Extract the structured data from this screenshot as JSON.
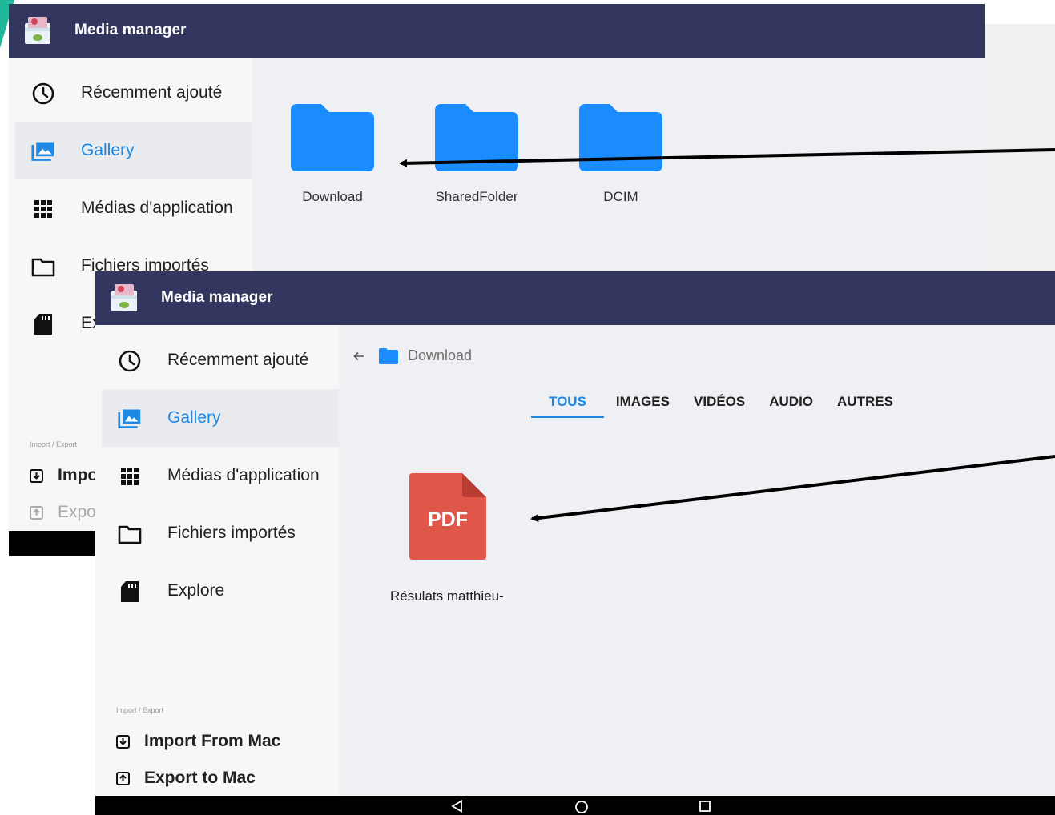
{
  "app": {
    "title": "Media manager"
  },
  "window1": {
    "sidebar": [
      {
        "label": "Récemment ajouté",
        "icon": "clock-icon"
      },
      {
        "label": "Gallery",
        "icon": "gallery-icon",
        "active": true
      },
      {
        "label": "Médias d'application",
        "icon": "grid-icon"
      },
      {
        "label": "Fichiers importés",
        "icon": "folder-outline-icon"
      },
      {
        "label": "Ex",
        "icon": "sd-card-icon"
      }
    ],
    "section_label": "Import / Export",
    "import_export": [
      {
        "label": "Impo",
        "icon": "import-icon"
      },
      {
        "label": "Expo",
        "icon": "export-icon",
        "disabled": true
      }
    ],
    "folders": [
      "Download",
      "SharedFolder",
      "DCIM"
    ]
  },
  "window2": {
    "sidebar": [
      {
        "label": "Récemment ajouté",
        "icon": "clock-icon"
      },
      {
        "label": "Gallery",
        "icon": "gallery-icon",
        "active": true
      },
      {
        "label": "Médias d'application",
        "icon": "grid-icon"
      },
      {
        "label": "Fichiers importés",
        "icon": "folder-outline-icon"
      },
      {
        "label": "Explore",
        "icon": "sd-card-icon"
      }
    ],
    "section_label": "Import / Export",
    "import_export": [
      {
        "label": "Import From Mac",
        "icon": "import-icon"
      },
      {
        "label": "Export to Mac",
        "icon": "export-icon"
      }
    ],
    "breadcrumb": {
      "folder": "Download"
    },
    "tabs": [
      "TOUS",
      "IMAGES",
      "VIDÉOS",
      "AUDIO",
      "AUTRES"
    ],
    "active_tab": "TOUS",
    "file": {
      "type_badge": "PDF",
      "name": "Résulats matthieu-"
    }
  },
  "colors": {
    "appbar": "#33365e",
    "accent": "#1e88e5",
    "folder": "#1a8cff",
    "pdf": "#e0574a"
  }
}
